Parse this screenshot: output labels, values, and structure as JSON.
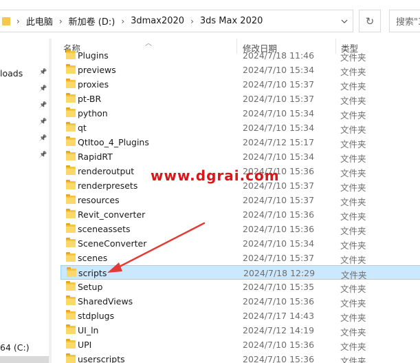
{
  "address_bar": {
    "crumbs": [
      "此电脑",
      "新加卷 (D:)",
      "3dmax2020",
      "3ds Max 2020"
    ],
    "separator": "›",
    "dropdown_icon": "chevron-down-icon",
    "refresh_icon": "refresh-icon",
    "search_placeholder": "搜索\"3"
  },
  "nav": {
    "items": [
      {
        "label": "loads",
        "pinned": true
      },
      {
        "label": "",
        "pinned": true
      },
      {
        "label": "",
        "pinned": true
      },
      {
        "label": "",
        "pinned": true
      },
      {
        "label": "",
        "pinned": true
      },
      {
        "label": "",
        "pinned": true
      }
    ],
    "drive_label": "64 (C:)"
  },
  "columns": {
    "name": "名称",
    "date": "修改日期",
    "type": "类型"
  },
  "rows": [
    {
      "name": "Plugins",
      "date": "2024/7/18 11:46",
      "type": "文件夹"
    },
    {
      "name": "previews",
      "date": "2024/7/10 15:34",
      "type": "文件夹"
    },
    {
      "name": "proxies",
      "date": "2024/7/10 15:37",
      "type": "文件夹"
    },
    {
      "name": "pt-BR",
      "date": "2024/7/10 15:37",
      "type": "文件夹"
    },
    {
      "name": "python",
      "date": "2024/7/10 15:34",
      "type": "文件夹"
    },
    {
      "name": "qt",
      "date": "2024/7/10 15:34",
      "type": "文件夹"
    },
    {
      "name": "QtItoo_4_Plugins",
      "date": "2024/7/12 15:17",
      "type": "文件夹"
    },
    {
      "name": "RapidRT",
      "date": "2024/7/10 15:34",
      "type": "文件夹"
    },
    {
      "name": "renderoutput",
      "date": "2024/7/10 15:36",
      "type": "文件夹"
    },
    {
      "name": "renderpresets",
      "date": "2024/7/10 15:37",
      "type": "文件夹"
    },
    {
      "name": "resources",
      "date": "2024/7/10 15:37",
      "type": "文件夹"
    },
    {
      "name": "Revit_converter",
      "date": "2024/7/10 15:36",
      "type": "文件夹"
    },
    {
      "name": "sceneassets",
      "date": "2024/7/10 15:36",
      "type": "文件夹"
    },
    {
      "name": "SceneConverter",
      "date": "2024/7/10 15:34",
      "type": "文件夹"
    },
    {
      "name": "scenes",
      "date": "2024/7/10 15:37",
      "type": "文件夹"
    },
    {
      "name": "scripts",
      "date": "2024/7/18 12:29",
      "type": "文件夹",
      "selected": true
    },
    {
      "name": "Setup",
      "date": "2024/7/10 15:35",
      "type": "文件夹"
    },
    {
      "name": "SharedViews",
      "date": "2024/7/10 15:36",
      "type": "文件夹"
    },
    {
      "name": "stdplugs",
      "date": "2024/7/17 14:43",
      "type": "文件夹"
    },
    {
      "name": "UI_ln",
      "date": "2024/7/12 14:19",
      "type": "文件夹"
    },
    {
      "name": "UPI",
      "date": "2024/7/10 15:36",
      "type": "文件夹"
    },
    {
      "name": "userscripts",
      "date": "2024/7/10 15:36",
      "type": "文件夹"
    }
  ],
  "watermark": "www.dgrai.com",
  "colors": {
    "selection_bg": "#cce8ff",
    "selection_border": "#99d1ff",
    "folder": "#f6c443",
    "annotation": "#e53935"
  }
}
